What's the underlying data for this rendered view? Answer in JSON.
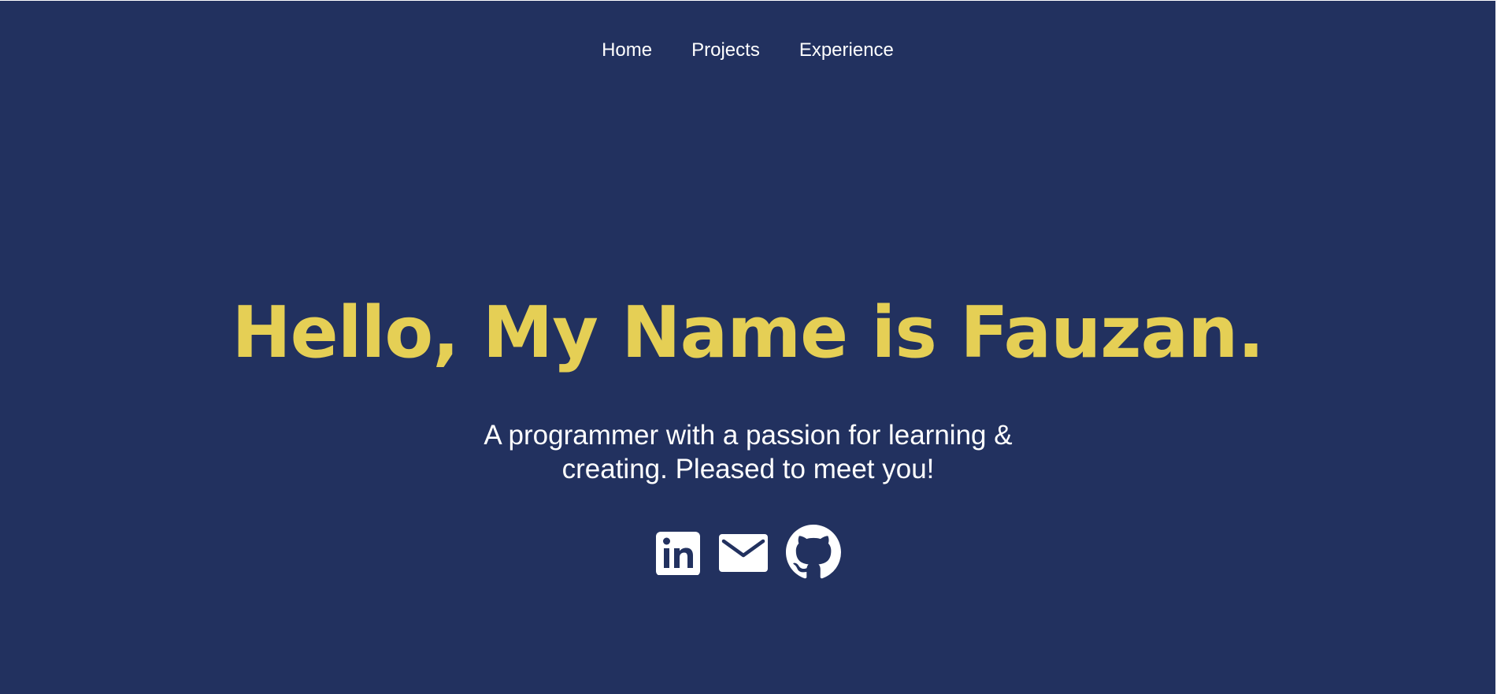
{
  "nav": {
    "items": [
      {
        "label": "Home"
      },
      {
        "label": "Projects"
      },
      {
        "label": "Experience"
      }
    ]
  },
  "hero": {
    "title": "Hello, My Name is Fauzan.",
    "subtitle": "A programmer with a passion for learning & creating. Pleased to meet you!"
  },
  "social": {
    "icons": [
      "linkedin-icon",
      "email-icon",
      "github-icon"
    ]
  },
  "colors": {
    "background": "#22315f",
    "accent": "#e5cf55",
    "text": "#ffffff"
  }
}
